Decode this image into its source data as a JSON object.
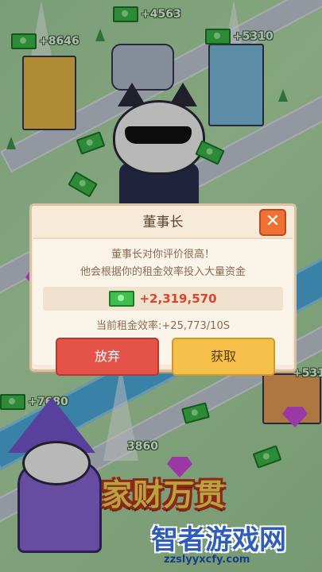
{
  "floating_rewards": [
    {
      "text": "+4563"
    },
    {
      "text": "+8646"
    },
    {
      "text": "+5310"
    },
    {
      "text": "+7680"
    },
    {
      "text": "3860"
    },
    {
      "text": "+531"
    }
  ],
  "dialog": {
    "title": "董事长",
    "close_label": "✕",
    "message_line1": "董事长对你评价很高！",
    "message_line2": "他会根据你的租金效率投入大量资金",
    "reward_amount": "+2,319,570",
    "efficiency_text": "当前租金效率:+25,773/10S",
    "abandon_label": "放弃",
    "accept_label": "获取"
  },
  "banner": {
    "slogan": "家财万贯"
  },
  "watermark": {
    "name": "智者游戏网",
    "url": "zzslyyxcfy.com"
  },
  "colors": {
    "accept": "#f4c04a",
    "abandon": "#e55248",
    "close": "#ef7133",
    "reward_text": "#d8462a"
  }
}
